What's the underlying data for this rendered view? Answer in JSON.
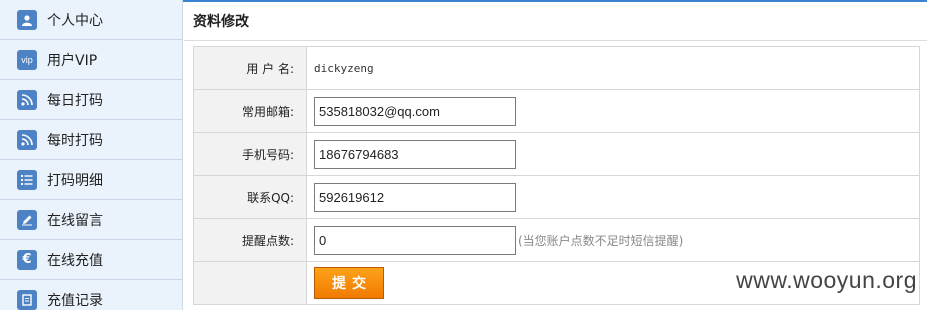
{
  "sidebar": {
    "items": [
      {
        "label": "个人中心",
        "icon": "user-icon"
      },
      {
        "label": "用户VIP",
        "icon": "vip-icon"
      },
      {
        "label": "每日打码",
        "icon": "rss-icon"
      },
      {
        "label": "每时打码",
        "icon": "rss-icon"
      },
      {
        "label": "打码明细",
        "icon": "list-icon"
      },
      {
        "label": "在线留言",
        "icon": "edit-icon"
      },
      {
        "label": "在线充值",
        "icon": "euro-icon"
      },
      {
        "label": "充值记录",
        "icon": "document-icon"
      }
    ]
  },
  "main": {
    "title": "资料修改",
    "form": {
      "username_label": "用 户 名:",
      "username_value": "dickyzeng",
      "email_label": "常用邮箱:",
      "email_value": "535818032@qq.com",
      "phone_label": "手机号码:",
      "phone_value": "18676794683",
      "qq_label": "联系QQ:",
      "qq_value": "592619612",
      "alert_label": "提醒点数:",
      "alert_value": "0",
      "alert_hint": "(当您账户点数不足时短信提醒)",
      "submit_label": "提交"
    }
  },
  "watermark": "www.wooyun.org",
  "colors": {
    "accent": "#3a83d0",
    "button": "#f07a00",
    "sidebar_bg": "#eaf3fc",
    "icon_bg": "#4d82c4"
  }
}
